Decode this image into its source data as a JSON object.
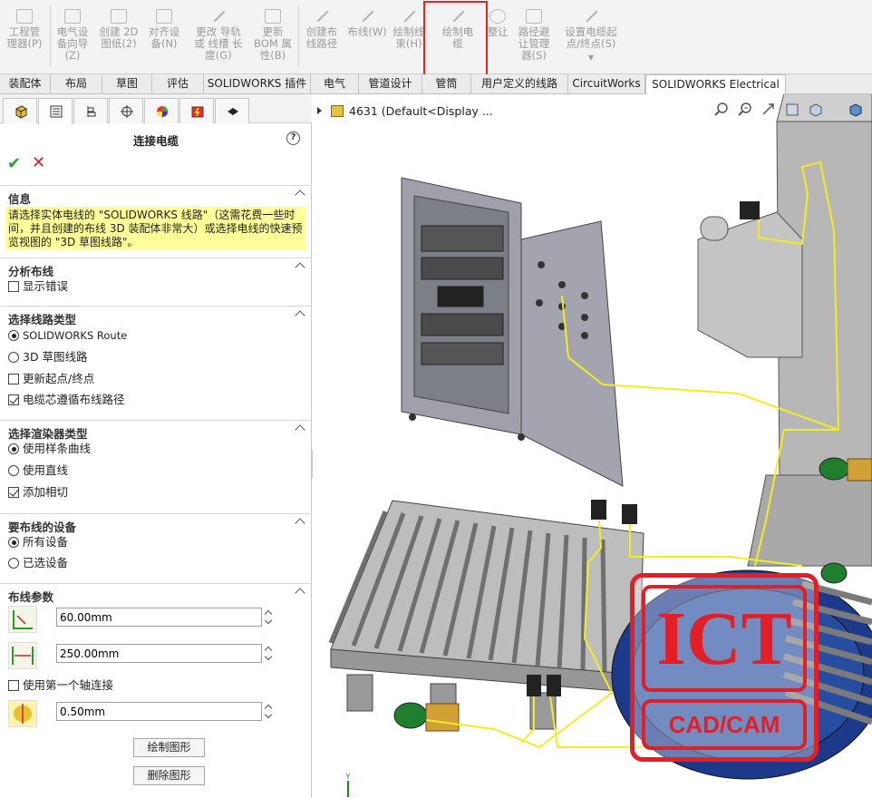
{
  "ribbon": {
    "buttons": [
      {
        "label": "工程管\n理器",
        "key": "(P)"
      },
      {
        "label": "电气设\n备向导",
        "key": "(Z)"
      },
      {
        "label": "创建 2D\n图纸",
        "key": "(2)"
      },
      {
        "label": "对齐设\n备",
        "key": "(N)"
      },
      {
        "label": "更改 导轨\n或 线槽 长\n度",
        "key": "(G)"
      },
      {
        "label": "更新\nBOM 属\n性",
        "key": "(B)"
      },
      {
        "label": "创建布\n线路径",
        "key": ""
      },
      {
        "label": "布线",
        "key": "(W)"
      },
      {
        "label": "绘制线\n束",
        "key": "(H)"
      },
      {
        "label": "绘制电\n缆",
        "key": ""
      },
      {
        "label": "整让",
        "key": ""
      },
      {
        "label": "路径避\n让管理\n器",
        "key": "(S)"
      },
      {
        "label": "设置电缆起\n点/终点",
        "key": "(S)"
      }
    ]
  },
  "tabs": [
    "装配体",
    "布局",
    "草图",
    "评估",
    "SOLIDWORKS 插件",
    "电气",
    "管道设计",
    "管筒",
    "用户定义的线路",
    "CircuitWorks",
    "SOLIDWORKS Electrical 3D"
  ],
  "panel": {
    "title": "连接电缆",
    "help": "?",
    "ok": "✔",
    "cancel": "✕",
    "info_header": "信息",
    "info_text": "请选择实体电线的 \"SOLIDWORKS 线路\"（这需花费一些时间，并且创建的布线 3D 装配体非常大）或选择电线的快速预览视图的 \"3D 草图线路\"。",
    "analyze_header": "分析布线",
    "show_errors": "显示错误",
    "route_type_header": "选择线路类型",
    "route_solidworks": "SOLIDWORKS Route",
    "route_3d": "3D 草图线路",
    "update_endpoints": "更新起点/终点",
    "core_follow": "电缆芯遵循布线路径",
    "renderer_header": "选择渲染器类型",
    "use_spline": "使用样条曲线",
    "use_line": "使用直线",
    "add_tangent": "添加相切",
    "devices_header": "要布线的设备",
    "all_devices": "所有设备",
    "selected_devices": "已选设备",
    "params_header": "布线参数",
    "param1": "60.00mm",
    "param2": "250.00mm",
    "use_first_axis": "使用第一个轴连接",
    "param3": "0.50mm",
    "draw_btn": "绘制图形",
    "delete_btn": "删除图形"
  },
  "viewport": {
    "tree_label": "4631  (Default<Display ...",
    "watermark_top": "ICT",
    "watermark_bottom": "CAD/CAM",
    "triad_label": "Y"
  }
}
